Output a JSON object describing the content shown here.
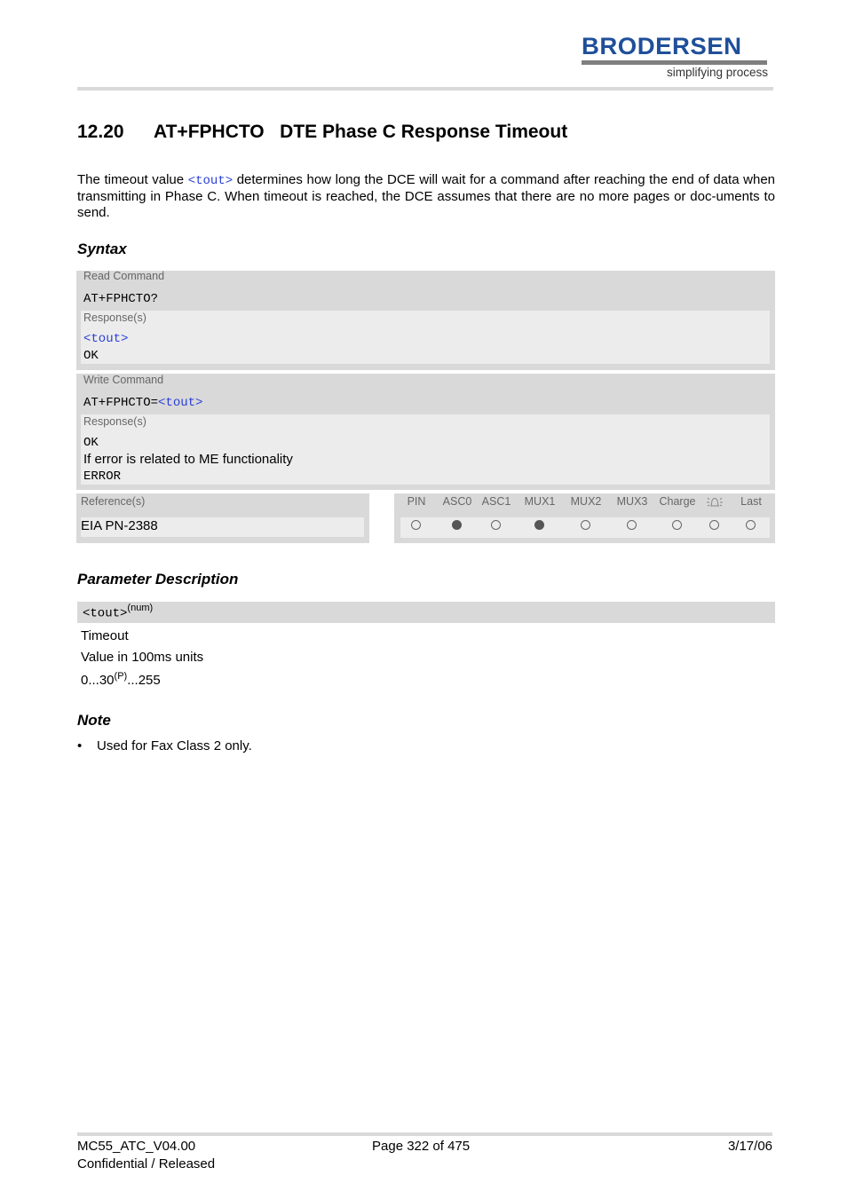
{
  "header": {
    "logo_text": "BRODERSEN",
    "logo_tagline": "simplifying process",
    "logo_color": "#1f4f9a"
  },
  "section": {
    "number": "12.20",
    "command": "AT+FPHCTO",
    "title": "DTE Phase C Response Timeout"
  },
  "intro": {
    "before": "The timeout value ",
    "param": "<tout>",
    "after": " determines how long the DCE will wait for a command after reaching the end of data when transmitting in Phase C. When timeout is reached, the DCE assumes that there are no more pages or doc-uments to send."
  },
  "syntax": {
    "heading": "Syntax",
    "read": {
      "label": "Read Command",
      "command": "AT+FPHCTO?",
      "response_label": "Response(s)",
      "response_param": "<tout>",
      "response_ok": "OK"
    },
    "write": {
      "label": "Write Command",
      "command_prefix": "AT+FPHCTO=",
      "command_param": "<tout>",
      "response_label": "Response(s)",
      "response_ok": "OK",
      "error_note": "If error is related to ME functionality",
      "response_error": "ERROR"
    },
    "reference": {
      "label": "Reference(s)",
      "value": "EIA PN-2388"
    },
    "pin_table": {
      "columns": [
        {
          "label": "PIN",
          "active": false
        },
        {
          "label": "ASC0",
          "active": true
        },
        {
          "label": "ASC1",
          "active": false
        },
        {
          "label": "MUX1",
          "active": true
        },
        {
          "label": "MUX2",
          "active": false
        },
        {
          "label": "MUX3",
          "active": false
        },
        {
          "label": "Charge",
          "active": false
        },
        {
          "label": "alarm-clock-icon",
          "active": false
        },
        {
          "label": "Last",
          "active": false
        }
      ]
    }
  },
  "parameters": {
    "heading": "Parameter Description",
    "items": [
      {
        "name": "<tout>",
        "type": "(num)",
        "lines": [
          "Timeout",
          "Value in 100ms units"
        ],
        "range_start": "0...30",
        "range_sup": "(P)",
        "range_end": "...255"
      }
    ]
  },
  "note": {
    "heading": "Note",
    "bullets": [
      "Used for Fax Class 2 only."
    ]
  },
  "footer": {
    "doc_id": "MC55_ATC_V04.00",
    "status": "Confidential / Released",
    "page": "Page 322 of 475",
    "date": "3/17/06"
  }
}
